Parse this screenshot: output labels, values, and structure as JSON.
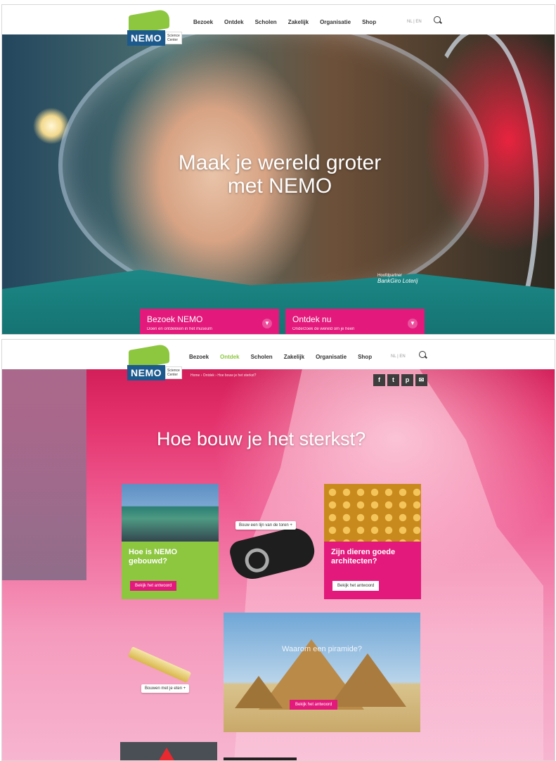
{
  "brand": {
    "logo_text": "NEMO",
    "logo_sub": "Science Center"
  },
  "nav": {
    "items": [
      "Bezoek",
      "Ontdek",
      "Scholen",
      "Zakelijk",
      "Organisatie",
      "Shop"
    ],
    "lang": "NL | EN"
  },
  "hero": {
    "title": "Maak je wereld groter met NEMO",
    "partner_label": "Hoofdpartner",
    "partner_name": "BankGiro Loterij",
    "cta": [
      {
        "title": "Bezoek NEMO",
        "subtitle": "Doen en ontdekken in het museum"
      },
      {
        "title": "Ontdek nu",
        "subtitle": "Onderzoek de wereld om je heen"
      }
    ]
  },
  "page2": {
    "active_nav": "Ontdek",
    "breadcrumb": "Home  ›  Ontdek  ›  Hoe bouw je het sterkst?",
    "social": [
      "f",
      "t",
      "p",
      "✉"
    ],
    "title": "Hoe bouw je het sterkst?",
    "cards": [
      {
        "question": "Hoe is NEMO gebouwd?",
        "button": "Bekijk het antwoord",
        "color": "#8dc63f"
      },
      {
        "question": "Zijn dieren goede architecten?",
        "button": "Bekijk het antwoord",
        "color": "#e3197c"
      }
    ],
    "tape_pill": "Bouw een lijn van de toren +",
    "pencil_pill": "Bouwen met je eten +",
    "pyramid": {
      "label": "Waarom een piramide?",
      "button": "Bekijk het antwoord"
    }
  },
  "colors": {
    "accent_pink": "#e3197c",
    "accent_green": "#8dc63f",
    "logo_blue": "#1c5a8e"
  }
}
